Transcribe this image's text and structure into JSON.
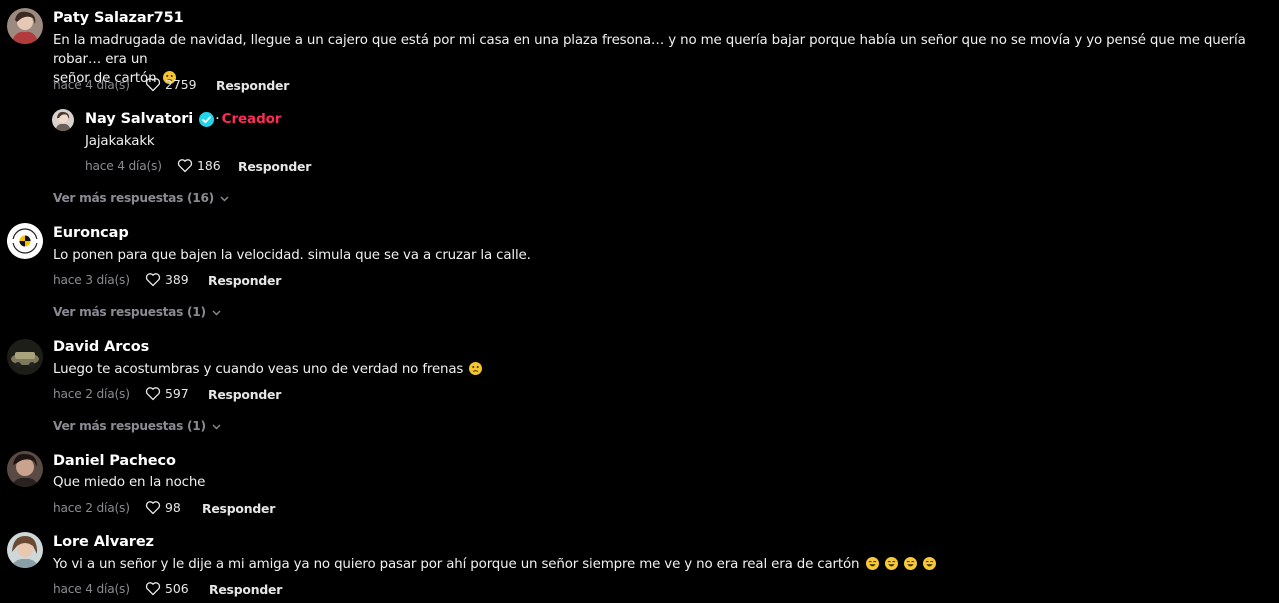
{
  "labels": {
    "reply": "Responder",
    "creator": "Creador"
  },
  "comments": [
    {
      "username": "Paty Salazar751",
      "text": "En la madrugada de navidad, llegue a un cajero que está por mi casa en una plaza fresona… y no me quería bajar porque había un señor que no se movía y yo pensé que me quería robar… era un\nseñor de cartón",
      "emoji": "😕",
      "time": "hace 4 día(s)",
      "likes": "2759",
      "reply": {
        "username": "Nay Salvatori",
        "text": "Jajakakakk",
        "time": "hace 4 día(s)",
        "likes": "186"
      },
      "more_replies": "Ver más respuestas (16)"
    },
    {
      "username": "Euroncap",
      "text": "Lo ponen para que bajen la velocidad. simula que se va a cruzar la calle.",
      "time": "hace 3 día(s)",
      "likes": "389",
      "more_replies": "Ver más respuestas (1)"
    },
    {
      "username": "David Arcos",
      "text": "Luego te acostumbras y cuando veas uno de verdad no frenas",
      "emoji": "😕",
      "time": "hace 2 día(s)",
      "likes": "597",
      "more_replies": "Ver más respuestas (1)"
    },
    {
      "username": "Daniel Pacheco",
      "text": "Que miedo en la noche",
      "time": "hace 2 día(s)",
      "likes": "98"
    },
    {
      "username": "Lore Alvarez",
      "text": "Yo vi a un señor y le dije a mi amiga ya no quiero pasar por ahí porque un señor siempre me ve y no era real era de cartón",
      "emoji": "😂😂😂😂",
      "time": "hace 4 día(s)",
      "likes": "506"
    }
  ],
  "colors": {
    "background": "#000000",
    "meta_text": "#8a8b91",
    "creator_tag": "#fe2c55",
    "verified": "#20d5ec"
  },
  "icons": [
    "heart-outline-icon",
    "chevron-down-icon",
    "verified-badge-icon",
    "emoji-icon"
  ]
}
